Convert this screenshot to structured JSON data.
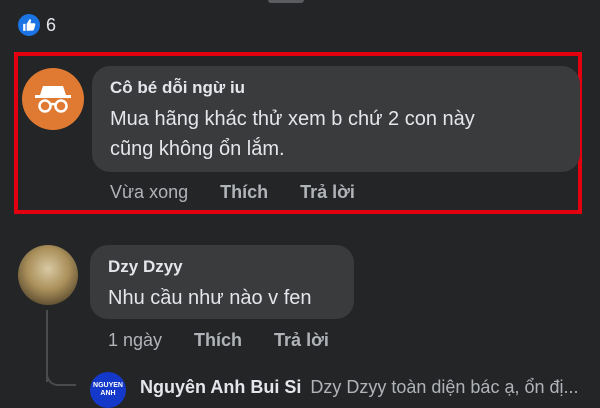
{
  "reactions": {
    "count": "6",
    "icon": "thumbs-up-icon",
    "color": "#1b74e4"
  },
  "highlight_color": "#e3000f",
  "comments": [
    {
      "author": "Cô bé dỗi ngừ iu",
      "avatar_icon": "incognito-icon",
      "text": "Mua hãng khác thử xem b chứ 2 con này\ncũng không ổn lắm.",
      "time": "Vừa xong",
      "like": "Thích",
      "reply": "Trả lời"
    },
    {
      "author": "Dzy Dzyy",
      "text": "Nhu cầu như nào v fen",
      "time": "1 ngày",
      "like": "Thích",
      "reply": "Trả lời"
    }
  ],
  "reply_preview": {
    "author": "Nguyên Anh Bui Si",
    "avatar_text": "NGUYEN ANH",
    "text": "Dzy Dzyy toàn diện bác ạ, ổn đị..."
  }
}
